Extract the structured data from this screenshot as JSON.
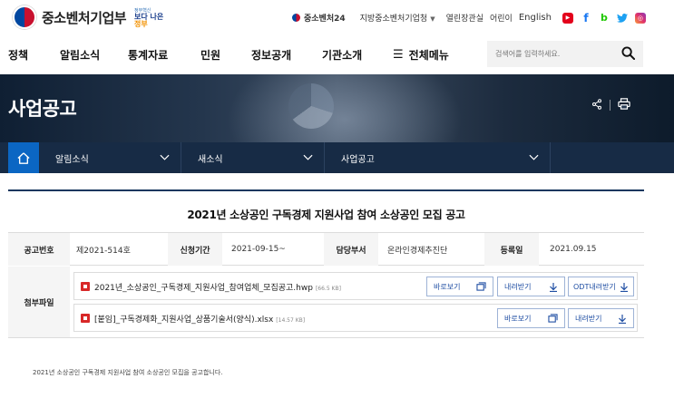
{
  "header": {
    "logo_text": "중소벤처기업부",
    "slogan_small": "정부혁신",
    "slogan_main_a": "보다 나은",
    "slogan_main_b": "정부",
    "top_links": {
      "brand": "중소벤처24",
      "agency": "지방중소벤처기업청",
      "open_office": "열린장관실",
      "kids": "어린이",
      "english": "English"
    },
    "sns": [
      {
        "name": "youtube-icon",
        "glyph": "▶"
      },
      {
        "name": "facebook-icon",
        "glyph": "f"
      },
      {
        "name": "blog-icon",
        "glyph": "b"
      },
      {
        "name": "twitter-icon",
        "glyph": "🐦"
      },
      {
        "name": "instagram-icon",
        "glyph": "◎"
      }
    ]
  },
  "nav": {
    "items": [
      "정책",
      "알림소식",
      "통계자료",
      "민원",
      "정보공개",
      "기관소개"
    ],
    "all_menu": "전체메뉴",
    "search_placeholder": "검색어를 입력하세요."
  },
  "hero": {
    "title": "사업공고"
  },
  "breadcrumb": {
    "items": [
      "알림소식",
      "새소식",
      "사업공고"
    ]
  },
  "post": {
    "title": "2021년 소상공인 구독경제 지원사업 참여 소상공인 모집 공고",
    "meta": {
      "no_label": "공고번호",
      "no_value": "제2021-514호",
      "period_label": "신청기간",
      "period_value": "2021-09-15~",
      "dept_label": "담당부서",
      "dept_value": "온라인경제추진단",
      "date_label": "등록일",
      "date_value": "2021.09.15"
    },
    "files_label": "첨부파일",
    "files": [
      {
        "name": "2021년_소상공인_구독경제_지원사업_참여업체_모집공고.hwp",
        "size": "[66.5 KB]"
      },
      {
        "name": "[붙임]_구독경제화_지원사업_상품기술서(양식).xlsx",
        "size": "[14.57 KB]"
      }
    ],
    "buttons": {
      "view": "바로보기",
      "download": "내려받기",
      "odt_download": "ODT내려받기"
    },
    "summary": "2021년 소상공인 구독경제 지원사업 참여 소상공인 모집을 공고합니다."
  },
  "colors": {
    "nav_dark": "#172b45",
    "home_blue": "#0b66c3",
    "button_text": "#1f4ea3",
    "file_icon_red": "#d82828"
  }
}
